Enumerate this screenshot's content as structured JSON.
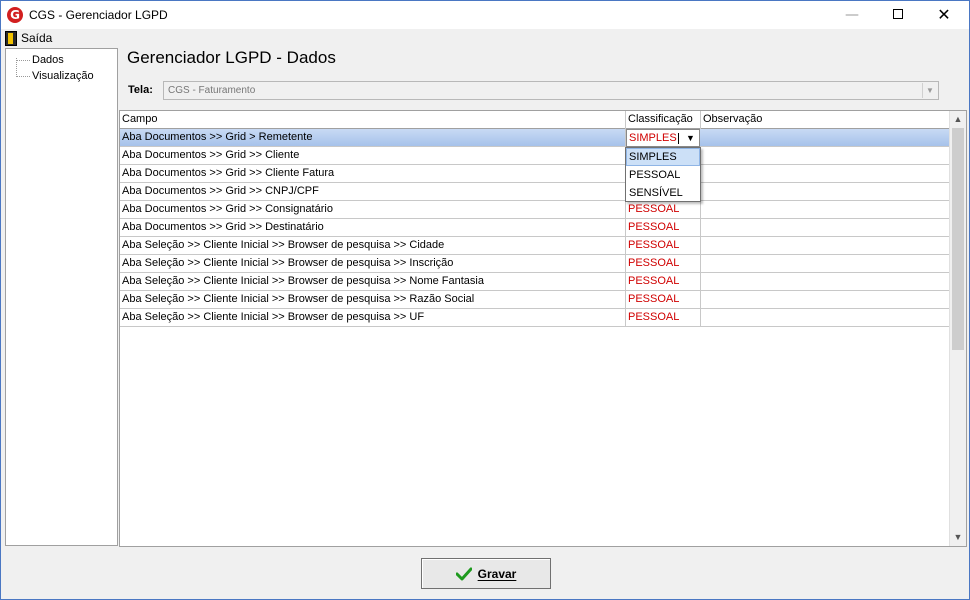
{
  "window": {
    "title": "CGS - Gerenciador LGPD",
    "app_icon_letter": "G",
    "min_glyph": "—",
    "close_glyph": "✕"
  },
  "menu": {
    "exit_label": "Saída"
  },
  "tree": {
    "items": [
      {
        "label": "Dados"
      },
      {
        "label": "Visualização"
      }
    ]
  },
  "page": {
    "title": "Gerenciador LGPD - Dados",
    "tela_label": "Tela:",
    "tela_value": "CGS - Faturamento"
  },
  "grid": {
    "columns": [
      "Campo",
      "Classificação",
      "Observação"
    ],
    "rows": [
      {
        "campo": "Aba Documentos >> Grid > Remetente",
        "classificacao": "SIMPLES",
        "observacao": ""
      },
      {
        "campo": "Aba Documentos >> Grid >> Cliente",
        "classificacao": "",
        "observacao": ""
      },
      {
        "campo": "Aba Documentos >> Grid >> Cliente Fatura",
        "classificacao": "",
        "observacao": ""
      },
      {
        "campo": "Aba Documentos >> Grid >> CNPJ/CPF",
        "classificacao": "",
        "observacao": ""
      },
      {
        "campo": "Aba Documentos >> Grid >> Consignatário",
        "classificacao": "PESSOAL",
        "observacao": ""
      },
      {
        "campo": "Aba Documentos >> Grid >> Destinatário",
        "classificacao": "PESSOAL",
        "observacao": ""
      },
      {
        "campo": "Aba Seleção >> Cliente Inicial >> Browser de pesquisa >> Cidade",
        "classificacao": "PESSOAL",
        "observacao": ""
      },
      {
        "campo": "Aba Seleção >> Cliente Inicial >> Browser de pesquisa >> Inscrição",
        "classificacao": "PESSOAL",
        "observacao": ""
      },
      {
        "campo": "Aba Seleção >> Cliente Inicial >> Browser de pesquisa >> Nome Fantasia",
        "classificacao": "PESSOAL",
        "observacao": ""
      },
      {
        "campo": "Aba Seleção >> Cliente Inicial >> Browser de pesquisa >> Razão Social",
        "classificacao": "PESSOAL",
        "observacao": ""
      },
      {
        "campo": "Aba Seleção >> Cliente Inicial >> Browser de pesquisa >> UF",
        "classificacao": "PESSOAL",
        "observacao": ""
      }
    ],
    "editor_value": "SIMPLES",
    "dropdown_options": [
      "SIMPLES",
      "PESSOAL",
      "SENSÍVEL"
    ],
    "dropdown_selected": "SIMPLES"
  },
  "footer": {
    "save_label": "Gravar"
  },
  "colors": {
    "classification_text": "#d00000",
    "selected_row": "#b4cdef",
    "title_border": "#4a77c3"
  }
}
